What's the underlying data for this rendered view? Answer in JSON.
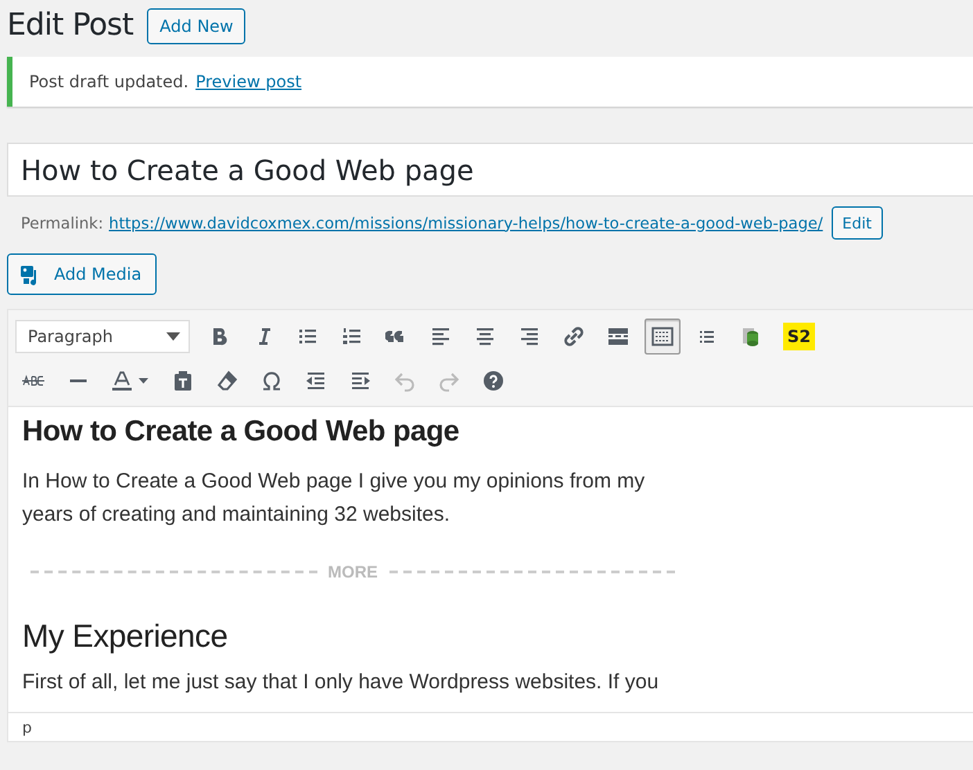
{
  "page_title": "Edit Post",
  "add_new_button": "Add New",
  "notice": {
    "text": "Post draft updated.",
    "link": "Preview post"
  },
  "post_title": "How to Create a Good Web page",
  "permalink": {
    "label": "Permalink:",
    "url": "https://www.davidcoxmex.com/missions/missionary-helps/how-to-create-a-good-web-page/",
    "edit_button": "Edit"
  },
  "add_media_button": "Add Media",
  "toolbar": {
    "format_select": "Paragraph",
    "toolbar_toggle": {
      "selected": true
    },
    "s2_button": "S2",
    "undo": {
      "disabled": true
    },
    "redo": {
      "disabled": true
    }
  },
  "content": {
    "heading": "How to Create a Good Web page",
    "intro": "In How to Create a Good Web page I give you my opinions from my years of creating and maintaining 32 websites.",
    "more_tag": "MORE",
    "subheading": "My Experience",
    "paragraph": "First of all, let me just say that I only have Wordpress websites. If you"
  },
  "status_bar": "p"
}
